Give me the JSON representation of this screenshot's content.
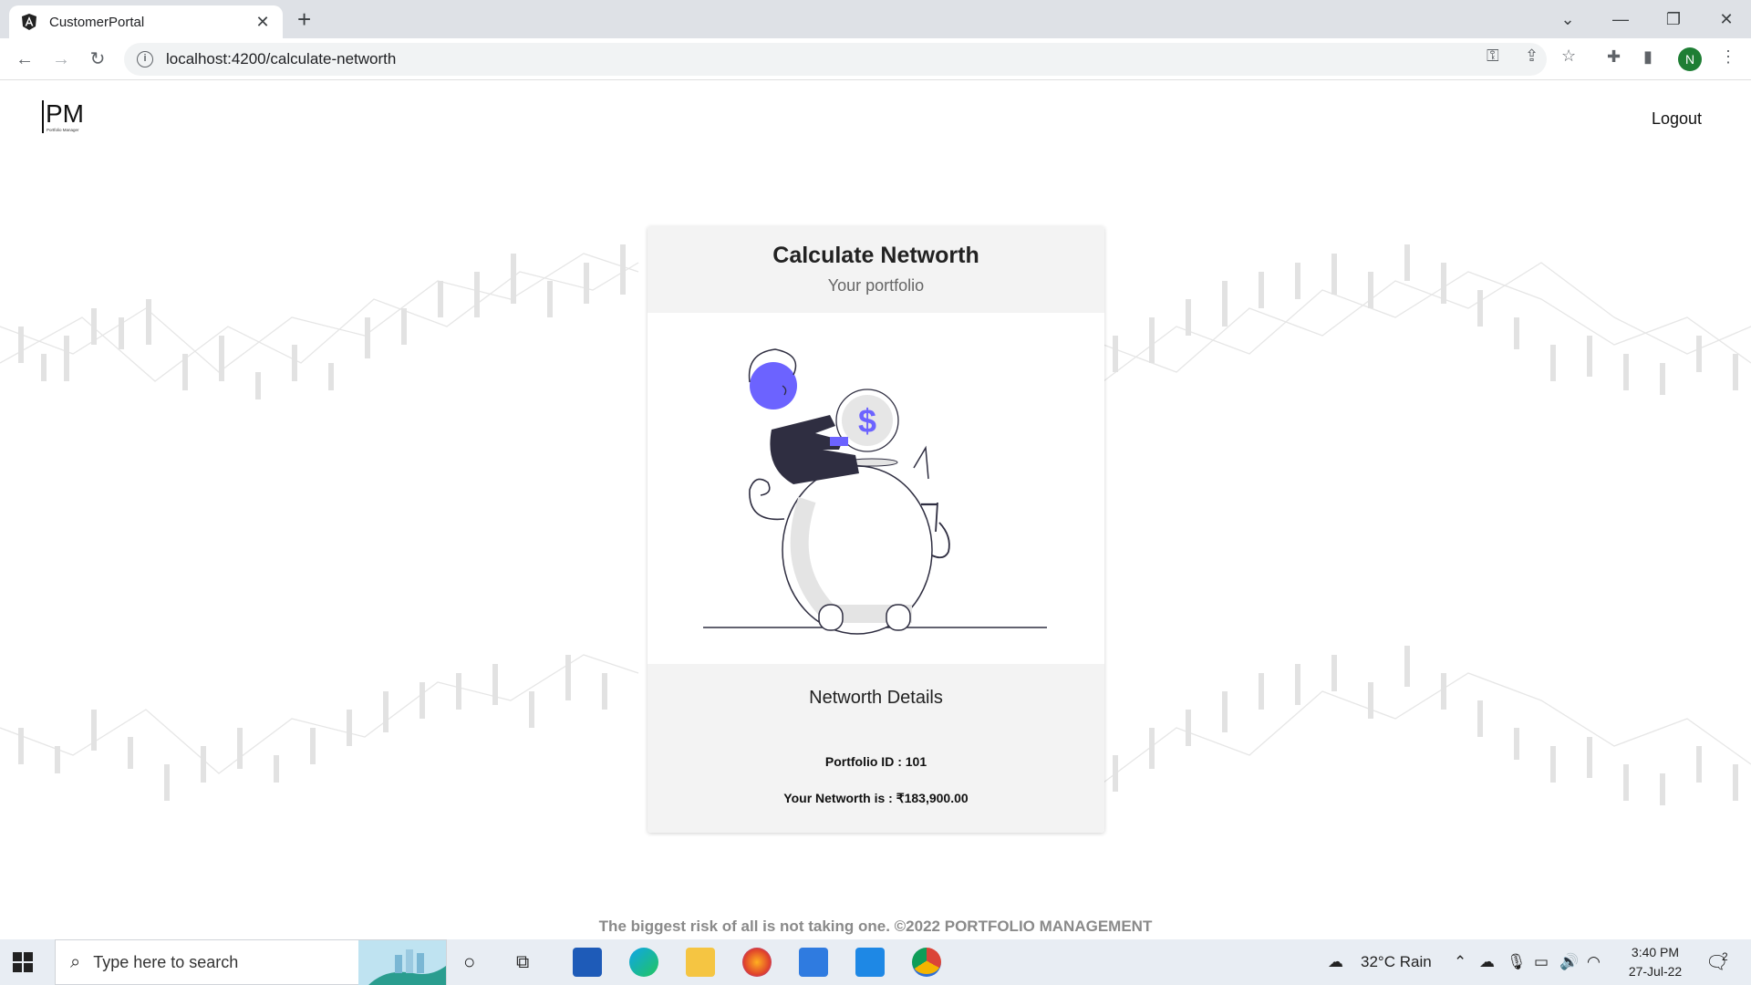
{
  "browser": {
    "tab_title": "CustomerPortal",
    "tab_close": "✕",
    "new_tab": "+",
    "url": "localhost:4200/calculate-networth",
    "profile_initial": "N"
  },
  "header": {
    "logo_text": "PM",
    "logo_subtext": "Portfolio Manager",
    "logout_label": "Logout"
  },
  "card": {
    "title": "Calculate Networth",
    "subtitle": "Your portfolio",
    "details_heading": "Networth Details",
    "portfolio_id_text": "Portfolio ID : 101",
    "networth_text": "Your Networth is : ₹183,900.00"
  },
  "footer": {
    "text": "The biggest risk of all is not taking one. ©2022 PORTFOLIO MANAGEMENT"
  },
  "taskbar": {
    "search_placeholder": "Type here to search",
    "weather": "32°C  Rain",
    "time": "3:40 PM",
    "date": "27-Jul-22",
    "notification_count": "2"
  },
  "colors": {
    "accent": "#6c63ff",
    "figure_dark": "#2f2e41",
    "card_header_bg": "#f3f3f3"
  }
}
